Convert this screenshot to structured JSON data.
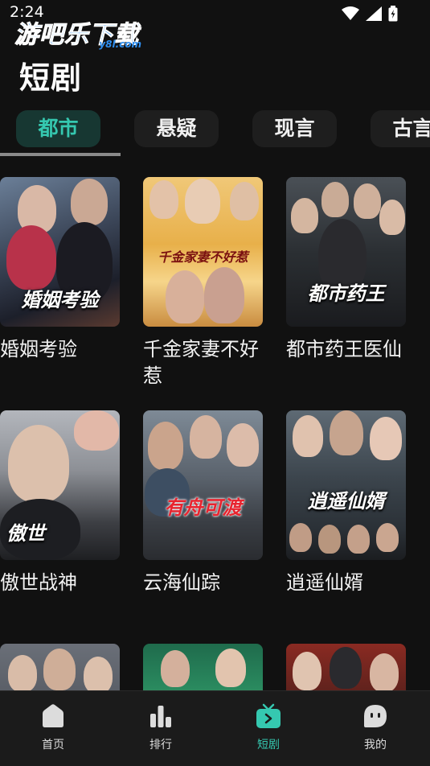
{
  "status": {
    "time": "2:24"
  },
  "watermark": {
    "main": "游吧乐下载",
    "sub": "y8l.com"
  },
  "page": {
    "title": "短剧"
  },
  "tabs": [
    {
      "label": "都市",
      "active": true
    },
    {
      "label": "悬疑",
      "active": false
    },
    {
      "label": "现言",
      "active": false
    },
    {
      "label": "古言",
      "active": false
    }
  ],
  "dramas": [
    {
      "title": "婚姻考验",
      "poster_text": "婚姻考验"
    },
    {
      "title": "千金家妻不好惹",
      "poster_text": "千金家妻不好惹"
    },
    {
      "title": "都市药王医仙",
      "poster_text": "都市药王"
    },
    {
      "title": "傲世战神",
      "poster_text": "傲世"
    },
    {
      "title": "云海仙踪",
      "poster_text": "有舟可渡"
    },
    {
      "title": "逍遥仙婿",
      "poster_text": "逍遥仙婿"
    }
  ],
  "bottom_nav": [
    {
      "label": "首页",
      "icon": "home-icon"
    },
    {
      "label": "排行",
      "icon": "ranking-icon"
    },
    {
      "label": "短剧",
      "icon": "tv-play-icon",
      "active": true
    },
    {
      "label": "我的",
      "icon": "profile-icon"
    }
  ],
  "colors": {
    "accent": "#35c8b0",
    "background": "#111111",
    "tab_bg": "#1e1e1e",
    "tab_active_bg": "#173732"
  }
}
